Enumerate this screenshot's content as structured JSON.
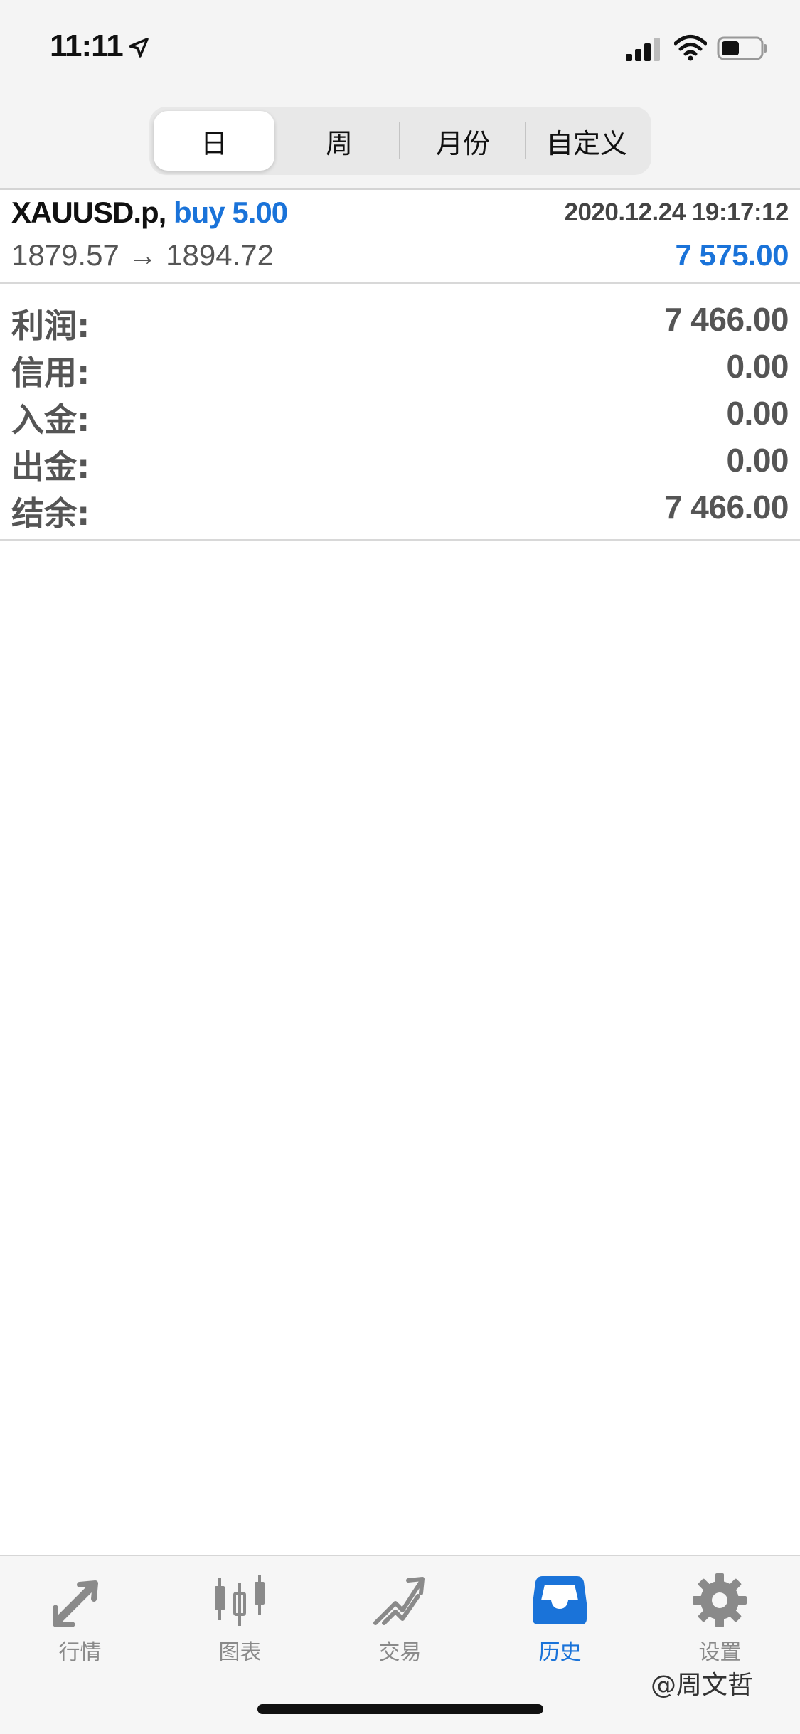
{
  "status_bar": {
    "time": "11:11"
  },
  "period_tabs": [
    {
      "label": "日",
      "active": true
    },
    {
      "label": "周",
      "active": false
    },
    {
      "label": "月份",
      "active": false
    },
    {
      "label": "自定义",
      "active": false
    }
  ],
  "trade": {
    "symbol": "XAUUSD.p,",
    "side": "buy 5.00",
    "datetime": "2020.12.24 19:17:12",
    "prices": "1879.57 → 1894.72",
    "profit": "7 575.00"
  },
  "summary": [
    {
      "label": "利润:",
      "value": "7 466.00"
    },
    {
      "label": "信用:",
      "value": "0.00"
    },
    {
      "label": "入金:",
      "value": "0.00"
    },
    {
      "label": "出金:",
      "value": "0.00"
    },
    {
      "label": "结余:",
      "value": "7 466.00"
    }
  ],
  "tab_bar": [
    {
      "label": "行情",
      "icon": "quotes-arrows-icon",
      "active": false
    },
    {
      "label": "图表",
      "icon": "candlestick-chart-icon",
      "active": false
    },
    {
      "label": "交易",
      "icon": "trade-arrow-icon",
      "active": false
    },
    {
      "label": "历史",
      "icon": "history-inbox-icon",
      "active": true
    },
    {
      "label": "设置",
      "icon": "gear-icon",
      "active": false
    }
  ],
  "watermark": "@周文哲",
  "colors": {
    "accent": "#1a73d9",
    "inactive": "#8a8a8a"
  }
}
